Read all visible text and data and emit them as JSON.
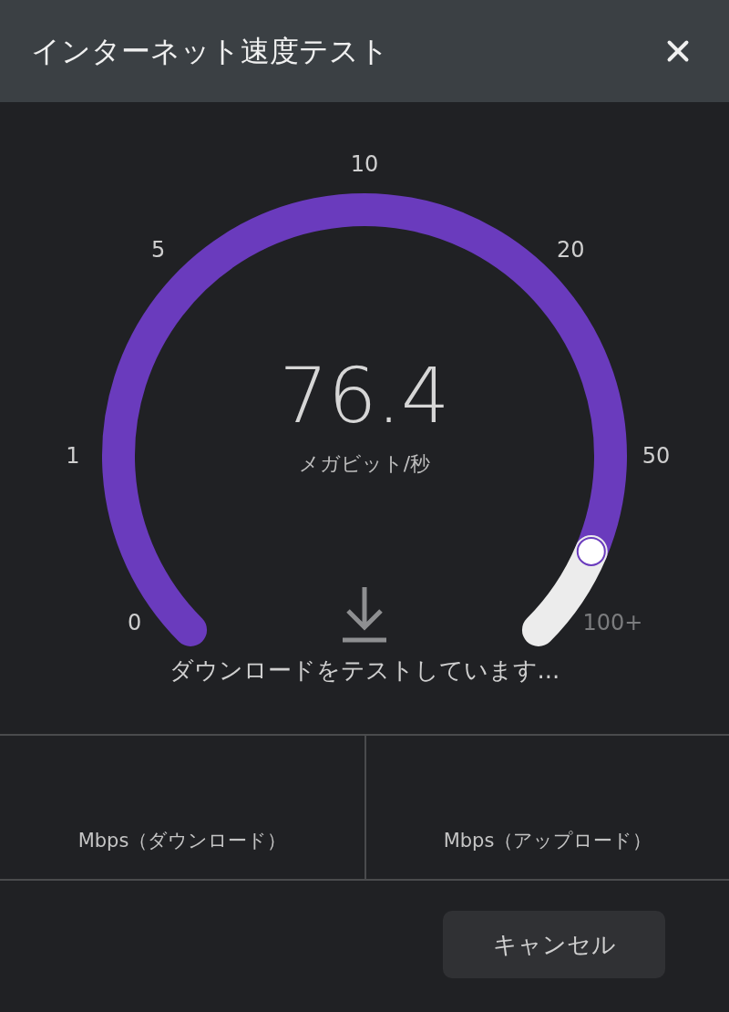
{
  "header": {
    "title": "インターネット速度テスト"
  },
  "gauge": {
    "ticks": [
      "0",
      "1",
      "5",
      "10",
      "20",
      "50",
      "100+"
    ],
    "value": "76.4",
    "unit": "メガビット/秒"
  },
  "status": "ダウンロードをテストしています...",
  "results": [
    {
      "label": "Mbps（ダウンロード）"
    },
    {
      "label": "Mbps（アップロード）"
    }
  ],
  "cancel_button": "キャンセル"
}
